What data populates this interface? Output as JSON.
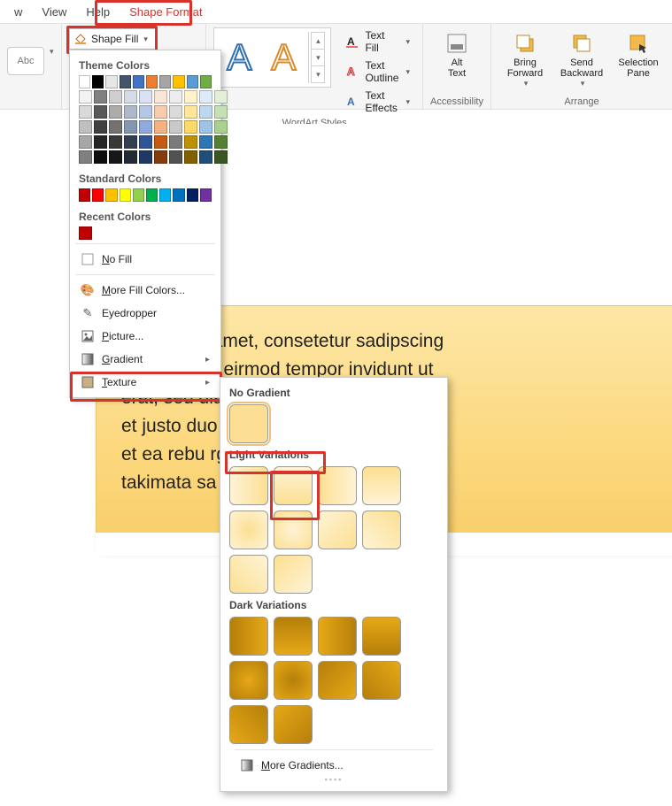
{
  "menubar": {
    "items": [
      "w",
      "View",
      "Help",
      "Shape Format"
    ],
    "active_index": 3
  },
  "ribbon": {
    "shape_fill_label": "Shape Fill",
    "insert_shapes": {
      "abc": "Abc"
    },
    "wordart": {
      "group_label": "WordArt Styles",
      "text_fill": "Text Fill",
      "text_outline": "Text Outline",
      "text_effects": "Text Effects"
    },
    "accessibility": {
      "group_label": "Accessibility",
      "alt_text": "Alt\nText"
    },
    "arrange": {
      "group_label": "Arrange",
      "bring_forward": "Bring\nForward",
      "send_backward": "Send\nBackward",
      "selection_pane": "Selection\nPane"
    }
  },
  "shape_fill_menu": {
    "theme_colors_label": "Theme Colors",
    "theme_row": [
      "#ffffff",
      "#000000",
      "#e7e6e6",
      "#44546a",
      "#4472c4",
      "#ed7d31",
      "#a5a5a5",
      "#ffc000",
      "#5b9bd5",
      "#70ad47"
    ],
    "tints": [
      [
        "#f2f2f2",
        "#d9d9d9",
        "#bfbfbf",
        "#a6a6a6",
        "#808080"
      ],
      [
        "#808080",
        "#595959",
        "#404040",
        "#262626",
        "#0d0d0d"
      ],
      [
        "#d0cece",
        "#aeabab",
        "#757171",
        "#3b3838",
        "#181717"
      ],
      [
        "#d6dce5",
        "#adb9ca",
        "#8497b0",
        "#333f50",
        "#222a35"
      ],
      [
        "#d9e1f3",
        "#b4c7e7",
        "#8faadc",
        "#2f5597",
        "#203864"
      ],
      [
        "#fbe5d6",
        "#f8cbad",
        "#f4b183",
        "#c55a11",
        "#843c0c"
      ],
      [
        "#ededed",
        "#dbdbdb",
        "#c9c9c9",
        "#7b7b7b",
        "#525252"
      ],
      [
        "#fff2cc",
        "#ffe699",
        "#ffd966",
        "#bf9000",
        "#806000"
      ],
      [
        "#deebf7",
        "#bdd7ee",
        "#9dc3e6",
        "#2e75b6",
        "#1f4e79"
      ],
      [
        "#e2f0d9",
        "#c5e0b4",
        "#a9d18e",
        "#548235",
        "#385723"
      ]
    ],
    "standard_colors_label": "Standard Colors",
    "standard_row": [
      "#c00000",
      "#ff0000",
      "#ffc000",
      "#ffff00",
      "#92d050",
      "#00b050",
      "#00b0f0",
      "#0070c0",
      "#002060",
      "#7030a0"
    ],
    "recent_colors_label": "Recent Colors",
    "recent_row": [
      "#c00000"
    ],
    "no_fill": "No Fill",
    "more_colors": "More Fill Colors...",
    "eyedropper": "Eyedropper",
    "picture": "Picture...",
    "gradient": "Gradient",
    "texture": "Texture"
  },
  "gradient_menu": {
    "no_gradient_label": "No Gradient",
    "light_label": "Light Variations",
    "dark_label": "Dark Variations",
    "more_gradients": "More Gradients..."
  },
  "document": {
    "shape_text": "m dolor sit amet, consetetur sadipscing\nam nonumy eirmod tempor invidunt ut\n                                             erat, sed diam\n                                     et justo duo dolores\net ea rebu                               rgren, no sea\ntakimata sa                              n dolor sit amet."
  }
}
